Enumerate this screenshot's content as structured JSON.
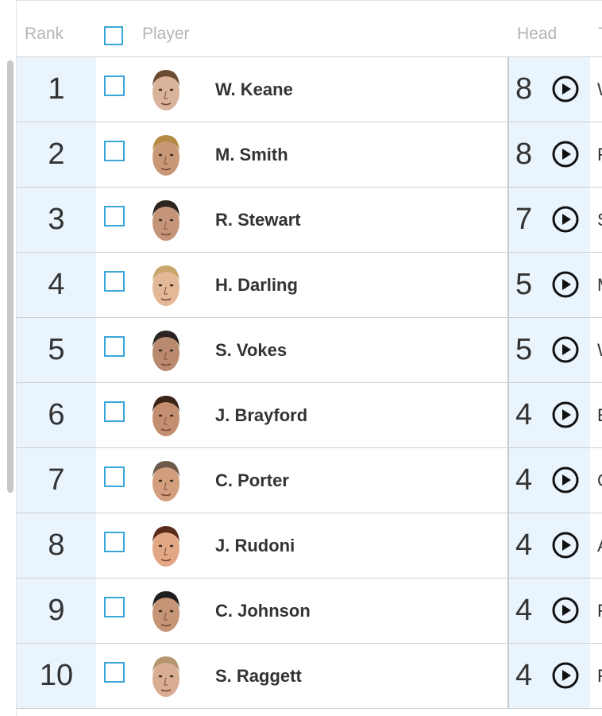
{
  "header": {
    "rank": "Rank",
    "player": "Player",
    "head": "Head",
    "next_col": "T"
  },
  "colors": {
    "accent": "#3ba6d8",
    "highlight_bg": "#eaf4fc",
    "text": "#333333"
  },
  "rows": [
    {
      "rank": "1",
      "name": "W. Keane",
      "head": "8",
      "next": "W",
      "skin": "#d9b39a",
      "hair": "#6b4b32"
    },
    {
      "rank": "2",
      "name": "M. Smith",
      "head": "8",
      "next": "F",
      "skin": "#c99877",
      "hair": "#b48b45"
    },
    {
      "rank": "3",
      "name": "R. Stewart",
      "head": "7",
      "next": "S",
      "skin": "#c5957a",
      "hair": "#2d2520"
    },
    {
      "rank": "4",
      "name": "H. Darling",
      "head": "5",
      "next": "M",
      "skin": "#e2b896",
      "hair": "#c9a66b"
    },
    {
      "rank": "5",
      "name": "S. Vokes",
      "head": "5",
      "next": "W",
      "skin": "#b98a6e",
      "hair": "#2a2522"
    },
    {
      "rank": "6",
      "name": "J. Brayford",
      "head": "4",
      "next": "E",
      "skin": "#c48f70",
      "hair": "#3a2518"
    },
    {
      "rank": "7",
      "name": "C. Porter",
      "head": "4",
      "next": "C",
      "skin": "#d29e7d",
      "hair": "#6b5a4a"
    },
    {
      "rank": "8",
      "name": "J. Rudoni",
      "head": "4",
      "next": "A",
      "skin": "#e2a784",
      "hair": "#5a2a1a"
    },
    {
      "rank": "9",
      "name": "C. Johnson",
      "head": "4",
      "next": "F",
      "skin": "#c69576",
      "hair": "#1f1f1f"
    },
    {
      "rank": "10",
      "name": "S. Raggett",
      "head": "4",
      "next": "F",
      "skin": "#d8ad92",
      "hair": "#b59670"
    }
  ]
}
